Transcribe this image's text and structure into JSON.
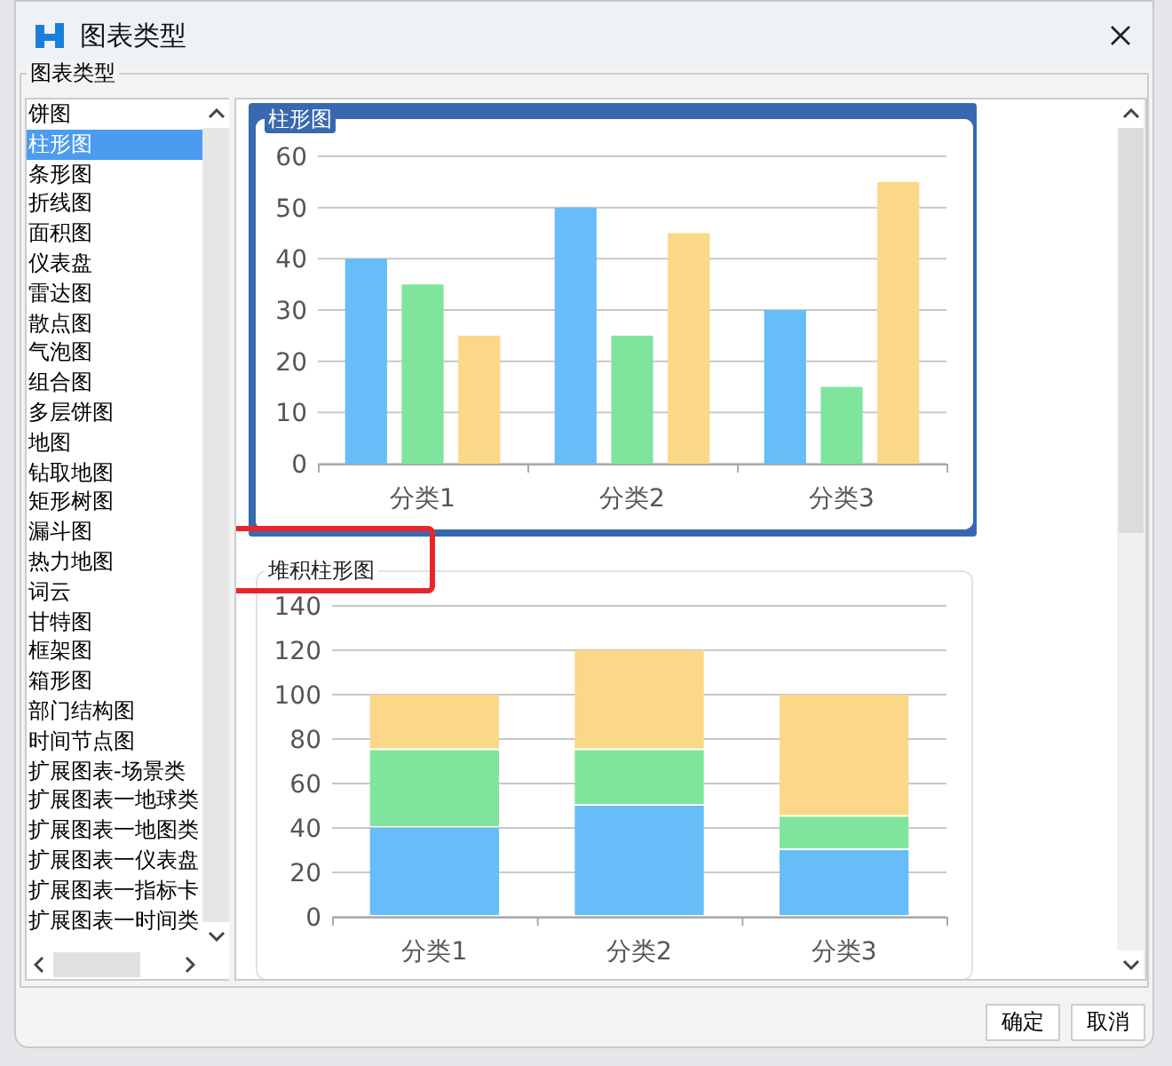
{
  "window": {
    "title": "图表类型"
  },
  "group": {
    "label": "图表类型"
  },
  "chart_types": [
    {
      "label": "饼图",
      "selected": false
    },
    {
      "label": "柱形图",
      "selected": true
    },
    {
      "label": "条形图",
      "selected": false
    },
    {
      "label": "折线图",
      "selected": false
    },
    {
      "label": "面积图",
      "selected": false
    },
    {
      "label": "仪表盘",
      "selected": false
    },
    {
      "label": "雷达图",
      "selected": false
    },
    {
      "label": "散点图",
      "selected": false
    },
    {
      "label": "气泡图",
      "selected": false
    },
    {
      "label": "组合图",
      "selected": false
    },
    {
      "label": "多层饼图",
      "selected": false
    },
    {
      "label": "地图",
      "selected": false
    },
    {
      "label": "钻取地图",
      "selected": false
    },
    {
      "label": "矩形树图",
      "selected": false
    },
    {
      "label": "漏斗图",
      "selected": false
    },
    {
      "label": "热力地图",
      "selected": false
    },
    {
      "label": "词云",
      "selected": false
    },
    {
      "label": "甘特图",
      "selected": false
    },
    {
      "label": "框架图",
      "selected": false
    },
    {
      "label": "箱形图",
      "selected": false
    },
    {
      "label": "部门结构图",
      "selected": false
    },
    {
      "label": "时间节点图",
      "selected": false
    },
    {
      "label": "扩展图表-场景类",
      "selected": false
    },
    {
      "label": "扩展图表一地球类",
      "selected": false
    },
    {
      "label": "扩展图表一地图类",
      "selected": false
    },
    {
      "label": "扩展图表一仪表盘",
      "selected": false
    },
    {
      "label": "扩展图表一指标卡",
      "selected": false
    },
    {
      "label": "扩展图表一时间类",
      "selected": false
    }
  ],
  "previews": [
    {
      "title": "柱形图",
      "selected": true,
      "highlighted": false,
      "chart_data": {
        "type": "bar",
        "categories": [
          "分类1",
          "分类2",
          "分类3"
        ],
        "series": [
          {
            "color": "#66bdf8",
            "values": [
              40,
              50,
              30
            ]
          },
          {
            "color": "#80e59c",
            "values": [
              35,
              25,
              15
            ]
          },
          {
            "color": "#fbd788",
            "values": [
              25,
              45,
              55
            ]
          }
        ],
        "ylim": [
          0,
          60
        ],
        "grid": true,
        "yticks": [
          0,
          10,
          20,
          30,
          40,
          50,
          60
        ],
        "stacked": false
      }
    },
    {
      "title": "堆积柱形图",
      "selected": false,
      "highlighted": true,
      "chart_data": {
        "type": "bar",
        "categories": [
          "分类1",
          "分类2",
          "分类3"
        ],
        "series": [
          {
            "color": "#66bdf8",
            "values": [
              40,
              50,
              30
            ]
          },
          {
            "color": "#80e59c",
            "values": [
              35,
              25,
              15
            ]
          },
          {
            "color": "#fbd788",
            "values": [
              25,
              45,
              55
            ]
          }
        ],
        "ylim": [
          0,
          140
        ],
        "grid": true,
        "yticks": [
          0,
          20,
          40,
          60,
          80,
          100,
          120,
          140
        ],
        "stacked": true
      }
    }
  ],
  "buttons": [
    {
      "label": "确定"
    },
    {
      "label": "取消"
    }
  ]
}
